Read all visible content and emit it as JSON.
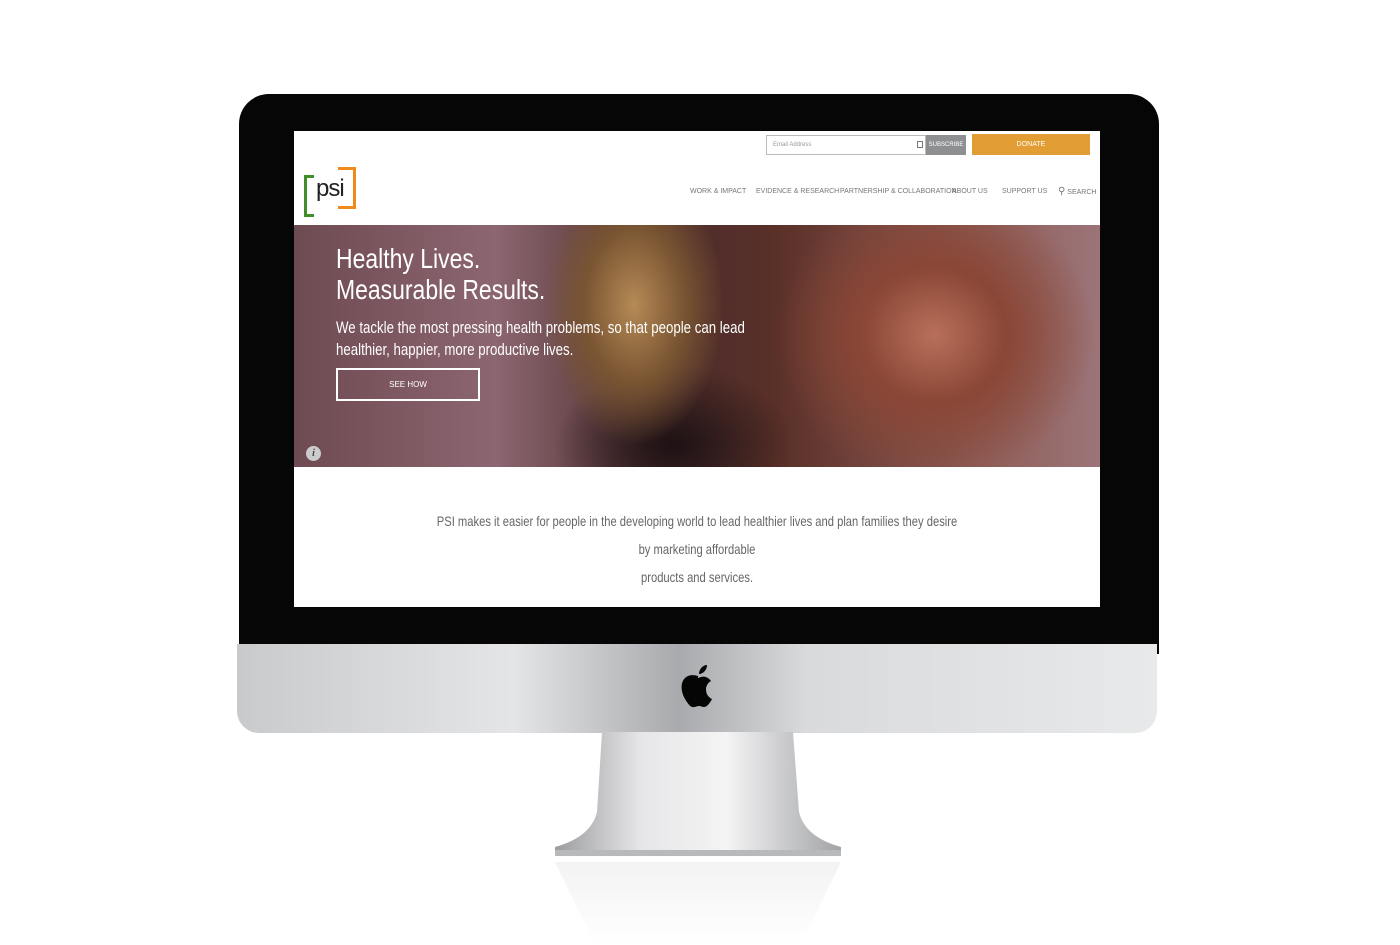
{
  "header": {
    "email_placeholder": "Email Address",
    "subscribe": "SUBSCRIBE",
    "donate": "DONATE",
    "logo_text": "psi",
    "nav": [
      "WORK & IMPACT",
      "EVIDENCE & RESEARCH",
      "PARTNERSHIP & COLLABORATION",
      "ABOUT US",
      "SUPPORT US",
      "SEARCH"
    ]
  },
  "hero": {
    "title_line1": "Healthy Lives.",
    "title_line2": "Measurable Results.",
    "lead_line1": "We tackle the most pressing health problems, so that people can lead",
    "lead_line2": "healthier, happier, more productive lives.",
    "cta": "SEE HOW"
  },
  "mission": {
    "line1": "PSI makes it easier for people in the developing world to lead healthier lives and plan families they desire by marketing affordable",
    "line2": "products and services."
  },
  "colors": {
    "donate": "#e39d35",
    "logo_green": "#3f8f2a",
    "logo_orange": "#f08a1c"
  }
}
